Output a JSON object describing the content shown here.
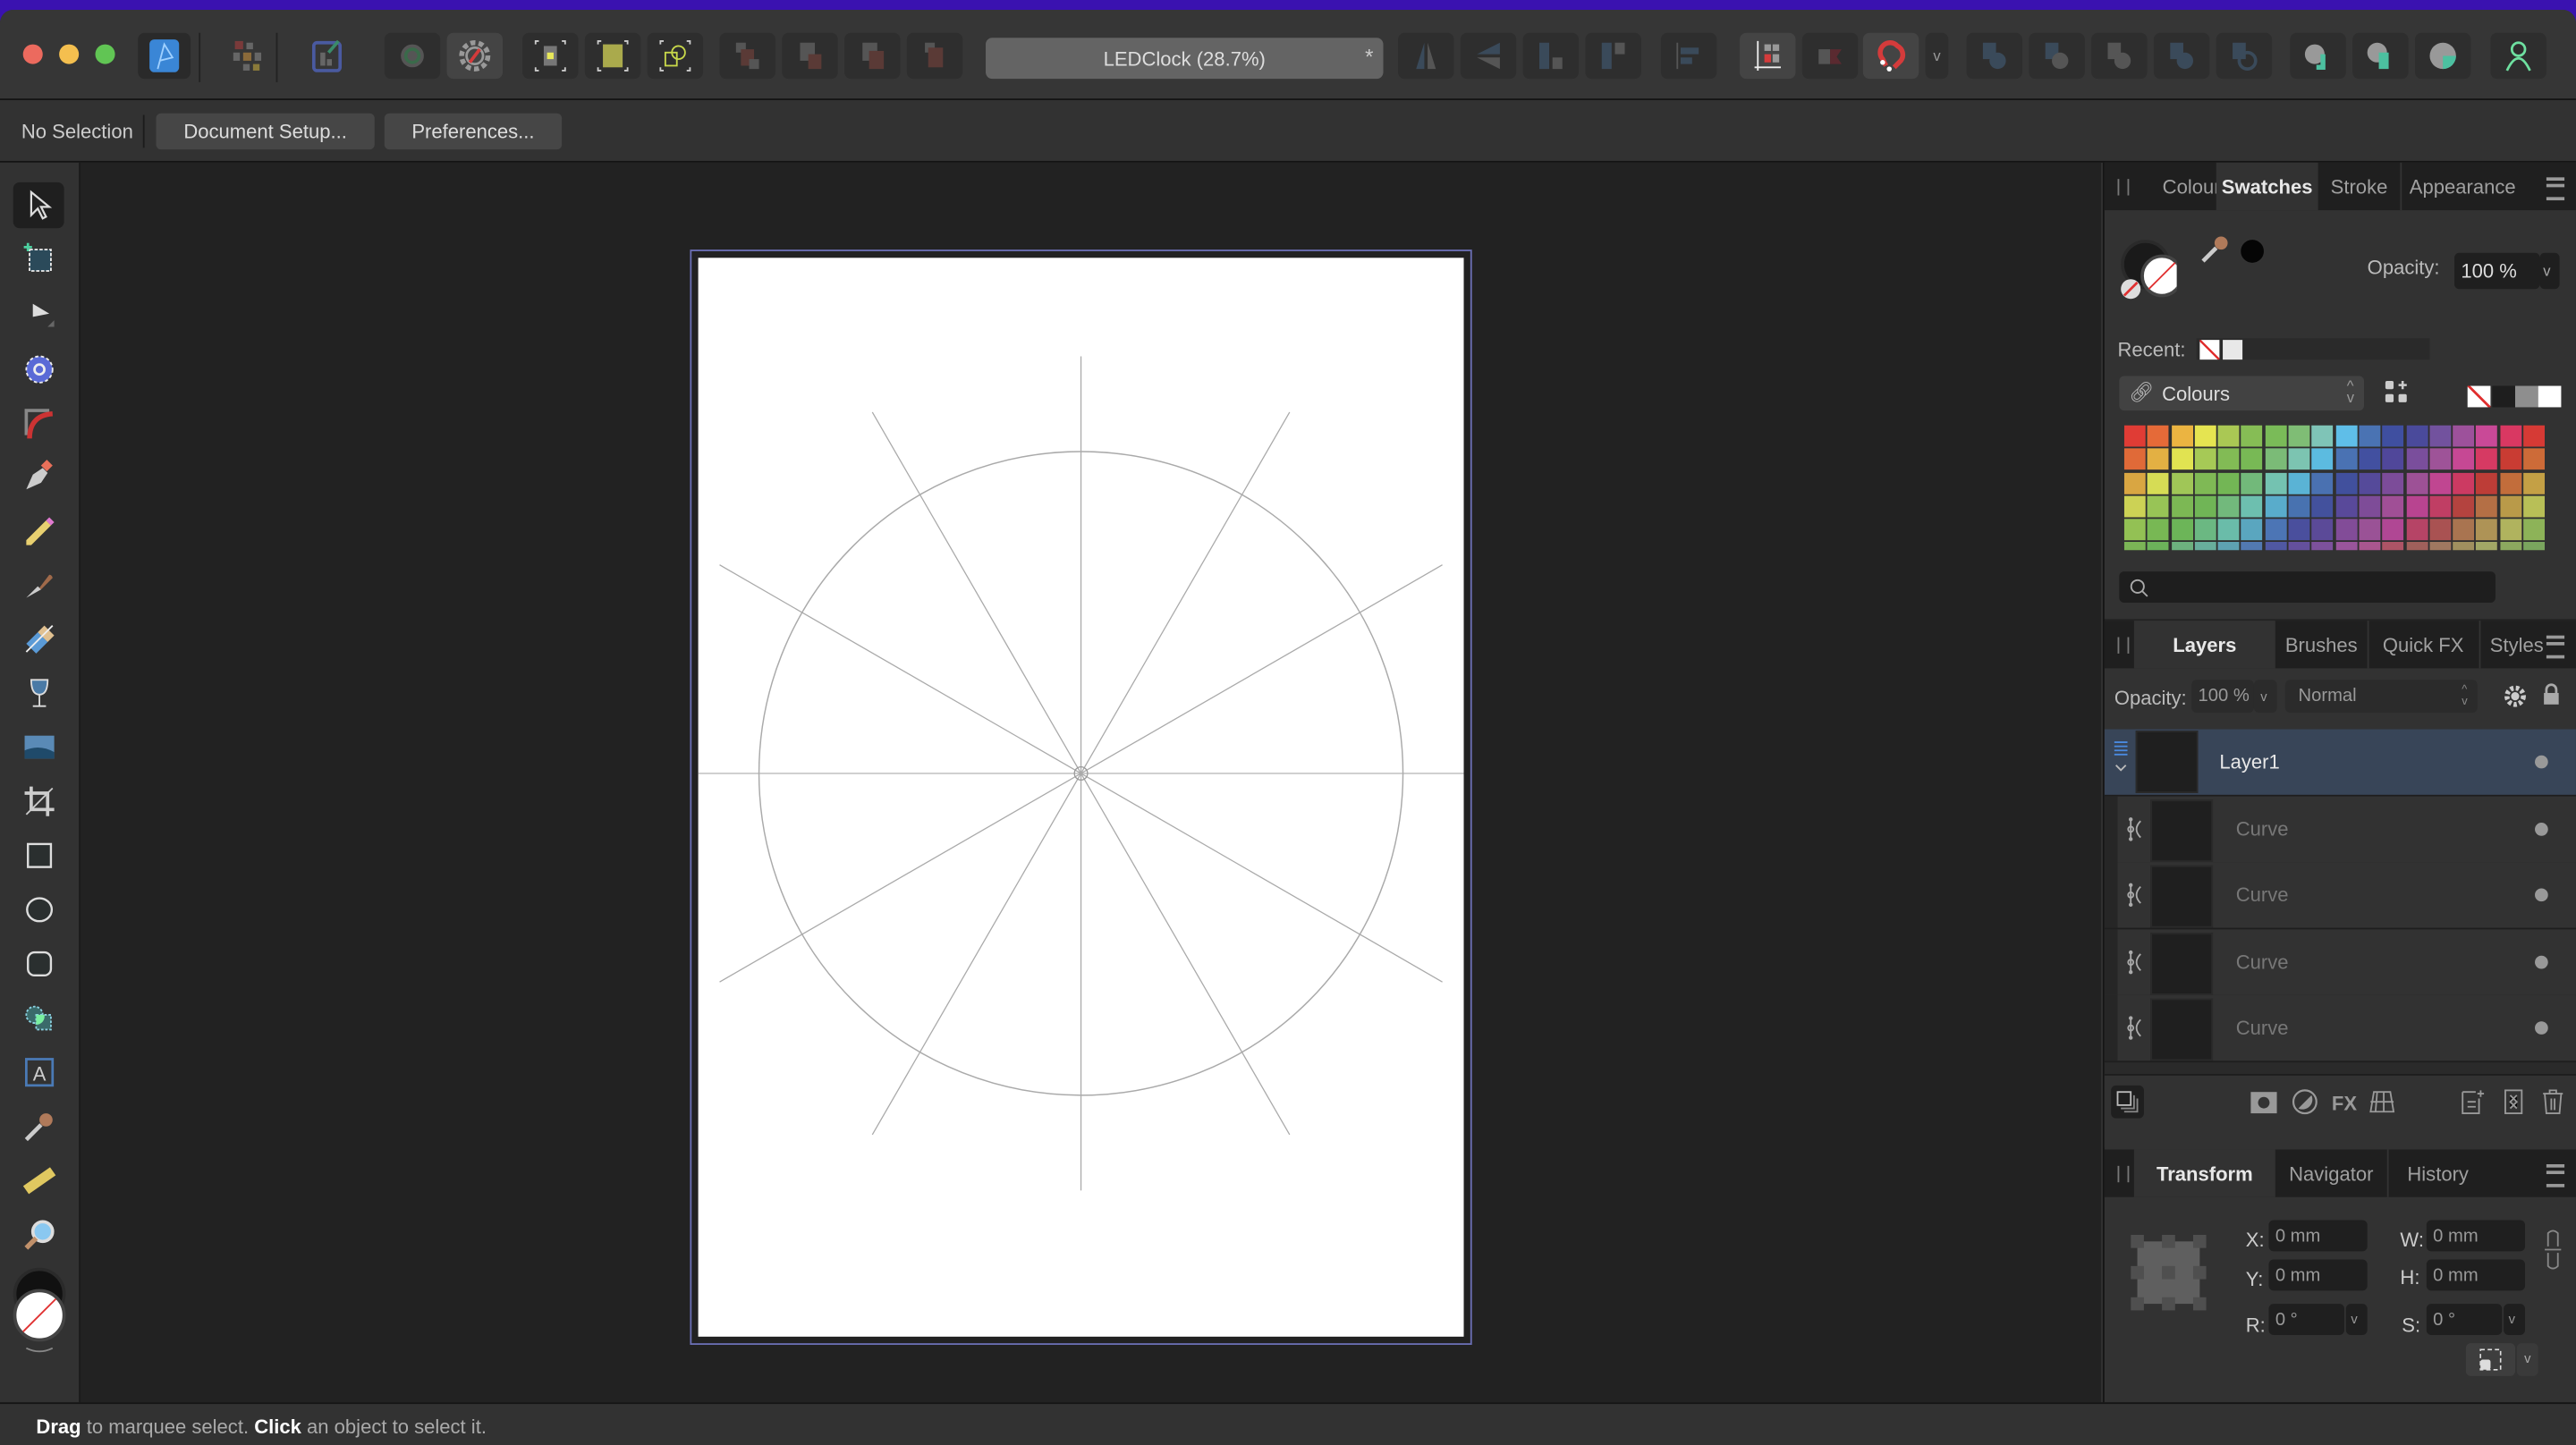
{
  "app": {
    "name": "Affinity Designer"
  },
  "toolbar": {
    "document_title": "LEDClock (28.7%)",
    "modified_marker": "*",
    "buttons": [
      {
        "name": "persona-designer",
        "icon": "designer-persona-icon"
      },
      {
        "name": "persona-pixel",
        "icon": "pixel-persona-icon"
      },
      {
        "name": "persona-export",
        "icon": "export-persona-icon"
      },
      {
        "name": "view-mode",
        "icon": "view-mode-icon"
      },
      {
        "name": "snap-settings",
        "icon": "gear-icon"
      },
      {
        "name": "pixel-grid",
        "icon": "pixel-grid-icon"
      },
      {
        "name": "pixel-align",
        "icon": "pixel-align-icon"
      },
      {
        "name": "move-by-whole",
        "icon": "transform-bounds-icon"
      },
      {
        "name": "arrange-back",
        "icon": "arrange-back-icon"
      },
      {
        "name": "arrange-backward",
        "icon": "arrange-backward-icon"
      },
      {
        "name": "arrange-forward",
        "icon": "arrange-forward-icon"
      },
      {
        "name": "arrange-front",
        "icon": "arrange-front-icon"
      },
      {
        "name": "flip-horizontal",
        "icon": "flip-horizontal-icon"
      },
      {
        "name": "flip-vertical",
        "icon": "flip-vertical-icon"
      },
      {
        "name": "rotate-left",
        "icon": "rotate-left-icon"
      },
      {
        "name": "rotate-right",
        "icon": "rotate-right-icon"
      },
      {
        "name": "align",
        "icon": "align-left-icon"
      },
      {
        "name": "transform-origin",
        "icon": "transform-origin-icon"
      },
      {
        "name": "toggle-snapping-candidates",
        "icon": "snapping-candidates-icon"
      },
      {
        "name": "snapping",
        "icon": "magnet-icon"
      },
      {
        "name": "snapping-options",
        "icon": "chevron-down-icon"
      },
      {
        "name": "boolean-add",
        "icon": "boolean-add-icon"
      },
      {
        "name": "boolean-subtract",
        "icon": "boolean-subtract-icon"
      },
      {
        "name": "boolean-intersect",
        "icon": "boolean-intersect-icon"
      },
      {
        "name": "boolean-xor",
        "icon": "boolean-xor-icon"
      },
      {
        "name": "boolean-divide",
        "icon": "boolean-divide-icon"
      },
      {
        "name": "insert-behind",
        "icon": "insert-behind-icon"
      },
      {
        "name": "insert-top",
        "icon": "insert-top-icon"
      },
      {
        "name": "insert-inside",
        "icon": "insert-inside-icon"
      },
      {
        "name": "assistant",
        "icon": "assistant-icon"
      }
    ]
  },
  "context_bar": {
    "selection_label": "No Selection",
    "document_setup": "Document Setup...",
    "preferences": "Preferences..."
  },
  "tools": [
    {
      "name": "move-tool",
      "icon": "pointer-icon",
      "active": true
    },
    {
      "name": "artboard-tool",
      "icon": "artboard-icon"
    },
    {
      "name": "node-tool",
      "icon": "node-arrow-icon"
    },
    {
      "name": "contour-tool",
      "icon": "contour-icon"
    },
    {
      "name": "corner-tool",
      "icon": "corner-icon"
    },
    {
      "name": "pen-tool",
      "icon": "pen-icon"
    },
    {
      "name": "pencil-tool",
      "icon": "pencil-icon"
    },
    {
      "name": "vector-brush-tool",
      "icon": "brush-icon"
    },
    {
      "name": "fill-tool",
      "icon": "gradient-icon"
    },
    {
      "name": "transparency-tool",
      "icon": "glass-icon"
    },
    {
      "name": "place-image-tool",
      "icon": "image-icon"
    },
    {
      "name": "vector-crop-tool",
      "icon": "crop-icon"
    },
    {
      "name": "rectangle-tool",
      "icon": "rectangle-icon"
    },
    {
      "name": "ellipse-tool",
      "icon": "ellipse-icon"
    },
    {
      "name": "rounded-rectangle-tool",
      "icon": "rounded-rectangle-icon"
    },
    {
      "name": "shape-builder-tool",
      "icon": "shape-builder-icon"
    },
    {
      "name": "artistic-text-tool",
      "icon": "text-icon"
    },
    {
      "name": "color-picker-tool",
      "icon": "eyedropper-icon"
    },
    {
      "name": "measure-tool",
      "icon": "ruler-icon"
    },
    {
      "name": "zoom-tool",
      "icon": "magnifier-icon"
    }
  ],
  "swatches_panel": {
    "tabs": [
      "Colour",
      "Swatches",
      "Stroke",
      "Appearance"
    ],
    "active_tab": "Swatches",
    "opacity_label": "Opacity:",
    "opacity_value": "100 %",
    "recent_label": "Recent:",
    "palette_name": "Colours",
    "search_placeholder": "",
    "swatch_colors": [
      "#e03c35",
      "#e56a38",
      "#ebb441",
      "#e5e451",
      "#aac854",
      "#86bd55",
      "#7abb58",
      "#7fbd75",
      "#7fc4b7",
      "#5fbee8",
      "#4a73b3",
      "#3f4fa0",
      "#4a4a9b",
      "#72529e",
      "#9d519b",
      "#c94997",
      "#d93862",
      "#d63a35",
      "#e06a38",
      "#e3b043",
      "#e1e351",
      "#a6c956",
      "#82bb55",
      "#78b955",
      "#7bbb77",
      "#7cc4b1",
      "#5cbbe0",
      "#4a72b3",
      "#4250a0",
      "#50479a",
      "#7a4e9c",
      "#9e5398",
      "#c64894",
      "#d63a63",
      "#c93c33",
      "#cd6b38",
      "#d9a642",
      "#d6dc55",
      "#a0c657",
      "#7fb955",
      "#73b655",
      "#72b97a",
      "#74c2b1",
      "#5ab3d5",
      "#4a71b1",
      "#41509d",
      "#554a9a",
      "#7c4c99",
      "#9d5196",
      "#c04691",
      "#cc3a62",
      "#bd3d37",
      "#c26d3b",
      "#c4a045",
      "#ccd255",
      "#98c456",
      "#7cb854",
      "#70b556",
      "#72b97c",
      "#6dbfaf",
      "#59accb",
      "#4872b0",
      "#43519d",
      "#59499a",
      "#7e4c98",
      "#a04f96",
      "#b84490",
      "#c03e64",
      "#b4433f",
      "#b46f45",
      "#b99a49",
      "#b8bf57",
      "#93c154",
      "#78b854",
      "#6cb558",
      "#6bb882",
      "#6abca9",
      "#5aa6bf",
      "#4c75b5",
      "#4a4f9d",
      "#5b4a98",
      "#824c98",
      "#9a5296",
      "#b04794",
      "#b64466",
      "#a95252",
      "#a97450",
      "#ae9356",
      "#b0b35e",
      "#8db358",
      "#7bb556",
      "#6cb25a",
      "#6db17e",
      "#68ae9c",
      "#5ea2b2",
      "#5279b1",
      "#5058a2",
      "#64509d",
      "#7d519c",
      "#9a559c",
      "#a9568f",
      "#ad5466",
      "#a0605b",
      "#a07860",
      "#a0905f",
      "#a2a766",
      "#8ca85f",
      "#7aa55e"
    ]
  },
  "layers_panel": {
    "tabs": [
      "Layers",
      "Brushes",
      "Quick FX",
      "Styles"
    ],
    "active_tab": "Layers",
    "opacity_label": "Opacity:",
    "opacity_value": "100 %",
    "blend_mode": "Normal",
    "layers": [
      {
        "name": "Layer1",
        "type": "layer",
        "selected": true,
        "visible": true
      },
      {
        "name": "Curve",
        "type": "curve",
        "visible": true
      },
      {
        "name": "Curve",
        "type": "curve",
        "visible": true
      },
      {
        "name": "Curve",
        "type": "curve",
        "visible": true
      },
      {
        "name": "Curve",
        "type": "curve",
        "visible": true
      }
    ]
  },
  "transform_panel": {
    "tabs": [
      "Transform",
      "Navigator",
      "History"
    ],
    "active_tab": "Transform",
    "x_label": "X:",
    "x_value": "0 mm",
    "y_label": "Y:",
    "y_value": "0 mm",
    "w_label": "W:",
    "w_value": "0 mm",
    "h_label": "H:",
    "h_value": "0 mm",
    "r_label": "R:",
    "r_value": "0 °",
    "s_label": "S:",
    "s_value": "0 °"
  },
  "status_bar": {
    "parts": [
      {
        "text": "Drag",
        "bold": true
      },
      {
        "text": " to marquee select. ",
        "bold": false
      },
      {
        "text": "Click",
        "bold": true
      },
      {
        "text": " an object to select it.",
        "bold": false
      }
    ]
  },
  "canvas": {
    "drawing": "clock guide: circle with 12 radial spokes (every 30°) through the centre"
  }
}
